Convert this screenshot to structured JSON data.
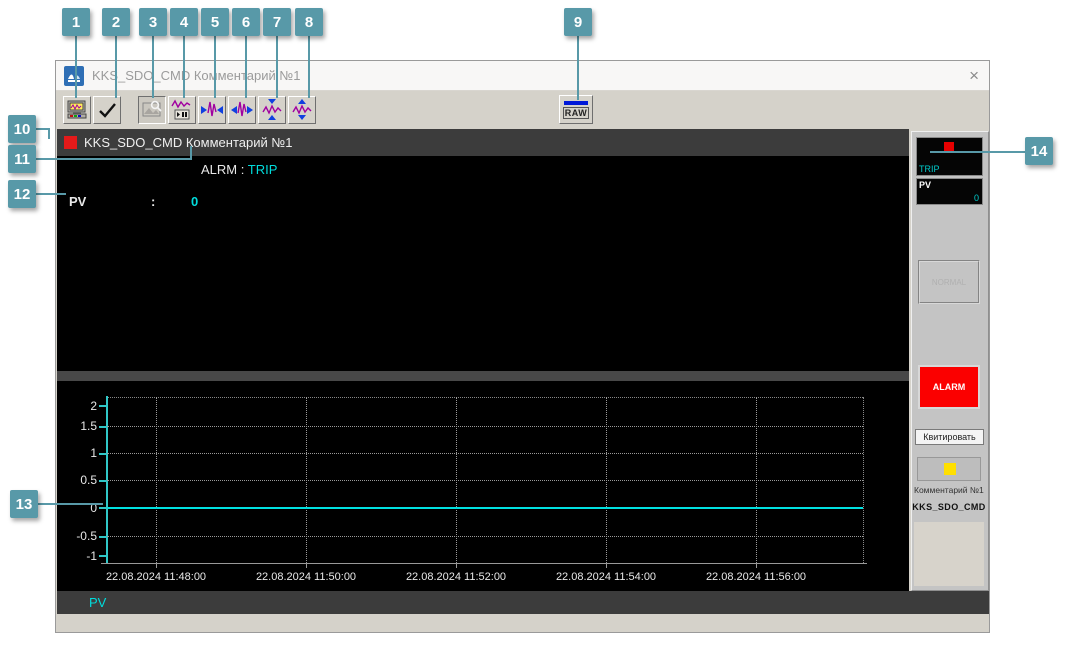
{
  "callouts": [
    "1",
    "2",
    "3",
    "4",
    "5",
    "6",
    "7",
    "8",
    "9",
    "10",
    "11",
    "12",
    "13",
    "14"
  ],
  "window": {
    "title": "KKS_SDO_CMD Комментарий №1",
    "close": "×"
  },
  "toolbar": {
    "buttons": [
      {
        "icon": "print-screen-icon"
      },
      {
        "icon": "checkmark-icon"
      },
      {
        "icon": "image-magnifier-icon"
      },
      {
        "icon": "trend-play-pause-icon"
      },
      {
        "icon": "trend-compress-horizontal-icon"
      },
      {
        "icon": "trend-expand-horizontal-icon"
      },
      {
        "icon": "trend-compress-vertical-icon"
      },
      {
        "icon": "trend-expand-vertical-icon"
      }
    ],
    "raw_label": "RAW"
  },
  "header": {
    "tag_title": "KKS_SDO_CMD Комментарий №1"
  },
  "status": {
    "alrm_label": "ALRM",
    "separator": ":",
    "alrm_value": "TRIP",
    "pv_label": "PV",
    "pv_value": "0"
  },
  "chart_data": {
    "type": "line",
    "title": "",
    "xlabel": "",
    "ylabel": "",
    "series": [
      {
        "name": "PV",
        "color": "#00e0e0",
        "values": [
          0,
          0,
          0,
          0,
          0,
          0,
          0,
          0,
          0,
          0
        ],
        "description": "flat line at 0 across entire time range"
      }
    ],
    "x_ticks": [
      "22.08.2024 11:48:00",
      "22.08.2024 11:50:00",
      "22.08.2024 11:52:00",
      "22.08.2024 11:54:00",
      "22.08.2024 11:56:00"
    ],
    "y_ticks": [
      "2",
      "1.5",
      "1",
      "0.5",
      "0",
      "-0.5",
      "-1"
    ],
    "ylim": [
      -1.15,
      2.15
    ],
    "grid": "dotted",
    "legend_position": "bottom-left"
  },
  "side_panel": {
    "trip_label": "TRIP",
    "pv_label": "PV",
    "pv_value": "0",
    "normal_button": "NORMAL",
    "alarm_button": "ALARM",
    "ack_button": "Квитировать",
    "comment_label": "Комментарий №1",
    "kks_label": "KKS_SDO_CMD"
  },
  "colors": {
    "callout_badge": "#5899a8",
    "accent_cyan": "#00dcdc",
    "alarm_red": "#fb0000",
    "indicator_red": "#e60000",
    "indicator_yellow": "#ffdf00",
    "panel_gray": "#c4c4c4",
    "strip_dark": "#3c3c3c",
    "toolbar_bg": "#d5d2ca"
  }
}
